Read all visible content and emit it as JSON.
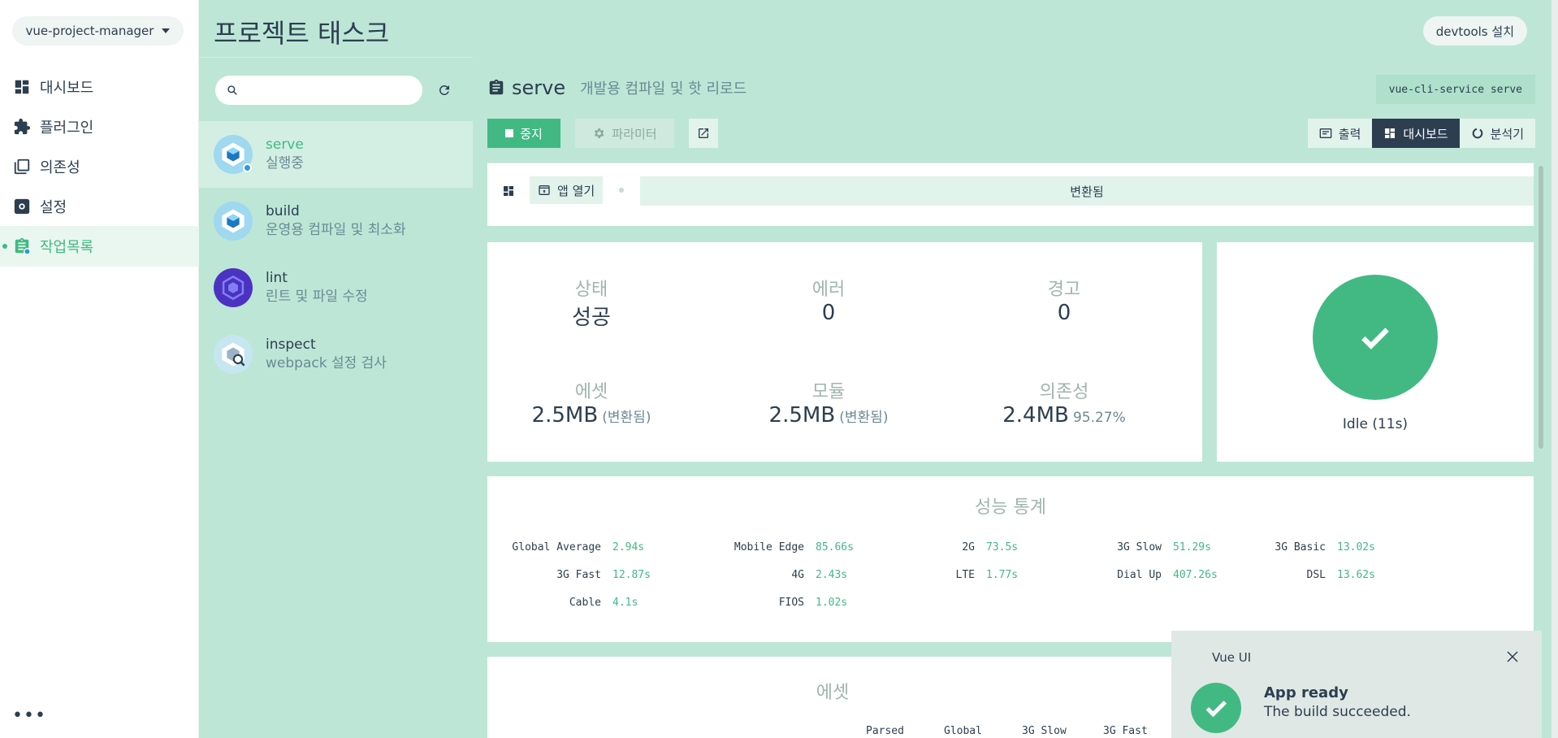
{
  "project_selector": {
    "label": "vue-project-manager"
  },
  "nav": {
    "items": [
      {
        "label": "대시보드",
        "icon": "dashboard-icon"
      },
      {
        "label": "플러그인",
        "icon": "puzzle-icon"
      },
      {
        "label": "의존성",
        "icon": "library-icon"
      },
      {
        "label": "설정",
        "icon": "gear-icon"
      },
      {
        "label": "작업목록",
        "icon": "clipboard-icon",
        "active": true
      }
    ],
    "more": "•••"
  },
  "header": {
    "title": "프로젝트 태스크",
    "devtools_label": "devtools 설치"
  },
  "task_list": {
    "search_placeholder": "",
    "tasks": [
      {
        "name": "serve",
        "desc": "실행중",
        "active": true,
        "running": true
      },
      {
        "name": "build",
        "desc": "운영용 컴파일 및 최소화"
      },
      {
        "name": "lint",
        "desc": "린트 및 파일 수정"
      },
      {
        "name": "inspect",
        "desc": "webpack 설정 검사"
      }
    ]
  },
  "task_detail": {
    "name": "serve",
    "description": "개발용 컴파일 및 핫 리로드",
    "command": "vue-cli-service serve",
    "stop_label": "중지",
    "params_label": "파라미터",
    "views": {
      "output": "출력",
      "dashboard": "대시보드",
      "analyzer": "분석기",
      "active": "dashboard"
    }
  },
  "dashboard": {
    "open_app_label": "앱 열기",
    "status_text": "변환됨",
    "stats": {
      "status": {
        "label": "상태",
        "value": "성공"
      },
      "errors": {
        "label": "에러",
        "value": "0"
      },
      "warnings": {
        "label": "경고",
        "value": "0"
      },
      "assets": {
        "label": "에셋",
        "value": "2.5MB",
        "sub": "(변환됨)"
      },
      "modules": {
        "label": "모듈",
        "value": "2.5MB",
        "sub": "(변환됨)"
      },
      "deps": {
        "label": "의존성",
        "value": "2.4MB",
        "sub": "95.27%"
      }
    },
    "idle_label": "Idle (11s)",
    "perf": {
      "title": "성능 통계",
      "rows": [
        [
          {
            "name": "Global Average",
            "value": "2.94s"
          },
          {
            "name": "Mobile Edge",
            "value": "85.66s"
          },
          {
            "name": "2G",
            "value": "73.5s"
          },
          {
            "name": "3G Slow",
            "value": "51.29s"
          },
          {
            "name": "3G Basic",
            "value": "13.02s"
          }
        ],
        [
          {
            "name": "3G Fast",
            "value": "12.87s"
          },
          {
            "name": "4G",
            "value": "2.43s"
          },
          {
            "name": "LTE",
            "value": "1.77s"
          },
          {
            "name": "Dial Up",
            "value": "407.26s"
          },
          {
            "name": "DSL",
            "value": "13.62s"
          }
        ],
        [
          {
            "name": "Cable",
            "value": "4.1s"
          },
          {
            "name": "FIOS",
            "value": "1.02s"
          }
        ]
      ]
    },
    "assets": {
      "title": "에셋",
      "columns": [
        "Parsed",
        "Global",
        "3G Slow",
        "3G Fast"
      ]
    }
  },
  "toast": {
    "app": "Vue UI",
    "title": "App ready",
    "message": "The build succeeded."
  },
  "colors": {
    "accent": "#42b983",
    "dark": "#2c3e50",
    "panel": "#bde6d6"
  }
}
